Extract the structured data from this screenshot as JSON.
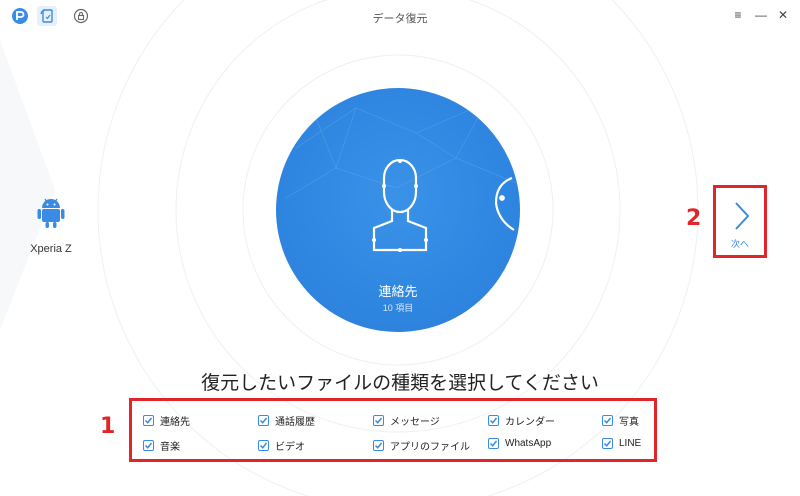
{
  "window": {
    "title": "データ復元",
    "controls": {
      "menu": "≡",
      "minimize": "—",
      "close": "✕"
    }
  },
  "toolbar": {
    "icons": [
      "logo-icon",
      "data-recovery-icon",
      "lock-icon"
    ]
  },
  "device": {
    "name": "Xperia Z",
    "icon": "android-icon"
  },
  "carousel": {
    "current_label": "連絡先",
    "current_count": "10 項目",
    "current_icon": "contact-icon",
    "next_peek_icon": "phone-icon"
  },
  "next_button": {
    "label": "次へ",
    "icon": "chevron-right-icon"
  },
  "heading": "復元したいファイルの種類を選択してください",
  "annotations": {
    "one": "1",
    "two": "2"
  },
  "data_types": {
    "row1": [
      "連絡先",
      "通話履歴",
      "メッセージ",
      "カレンダー",
      "写真"
    ],
    "row2": [
      "音楽",
      "ビデオ",
      "アプリのファイル",
      "WhatsApp",
      "LINE"
    ],
    "checked": true
  },
  "colors": {
    "accent": "#3a8be4",
    "circle": "#2f86e0",
    "annotation_red": "#e0262a"
  }
}
